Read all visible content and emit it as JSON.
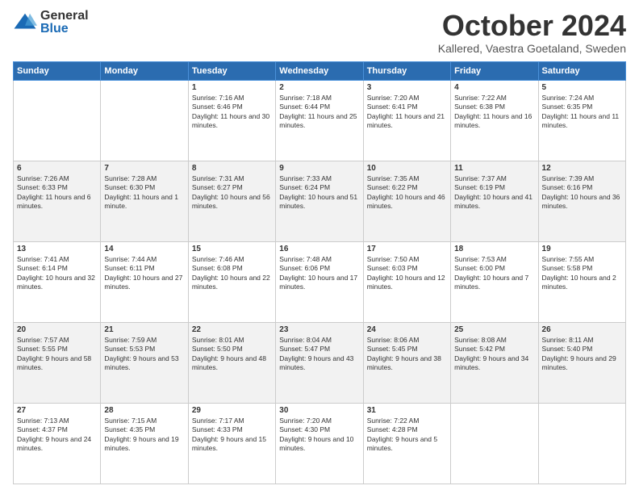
{
  "logo": {
    "general": "General",
    "blue": "Blue"
  },
  "title": "October 2024",
  "subtitle": "Kallered, Vaestra Goetaland, Sweden",
  "days_of_week": [
    "Sunday",
    "Monday",
    "Tuesday",
    "Wednesday",
    "Thursday",
    "Friday",
    "Saturday"
  ],
  "weeks": [
    [
      {
        "day": "",
        "sunrise": "",
        "sunset": "",
        "daylight": ""
      },
      {
        "day": "",
        "sunrise": "",
        "sunset": "",
        "daylight": ""
      },
      {
        "day": "1",
        "sunrise": "Sunrise: 7:16 AM",
        "sunset": "Sunset: 6:46 PM",
        "daylight": "Daylight: 11 hours and 30 minutes."
      },
      {
        "day": "2",
        "sunrise": "Sunrise: 7:18 AM",
        "sunset": "Sunset: 6:44 PM",
        "daylight": "Daylight: 11 hours and 25 minutes."
      },
      {
        "day": "3",
        "sunrise": "Sunrise: 7:20 AM",
        "sunset": "Sunset: 6:41 PM",
        "daylight": "Daylight: 11 hours and 21 minutes."
      },
      {
        "day": "4",
        "sunrise": "Sunrise: 7:22 AM",
        "sunset": "Sunset: 6:38 PM",
        "daylight": "Daylight: 11 hours and 16 minutes."
      },
      {
        "day": "5",
        "sunrise": "Sunrise: 7:24 AM",
        "sunset": "Sunset: 6:35 PM",
        "daylight": "Daylight: 11 hours and 11 minutes."
      }
    ],
    [
      {
        "day": "6",
        "sunrise": "Sunrise: 7:26 AM",
        "sunset": "Sunset: 6:33 PM",
        "daylight": "Daylight: 11 hours and 6 minutes."
      },
      {
        "day": "7",
        "sunrise": "Sunrise: 7:28 AM",
        "sunset": "Sunset: 6:30 PM",
        "daylight": "Daylight: 11 hours and 1 minute."
      },
      {
        "day": "8",
        "sunrise": "Sunrise: 7:31 AM",
        "sunset": "Sunset: 6:27 PM",
        "daylight": "Daylight: 10 hours and 56 minutes."
      },
      {
        "day": "9",
        "sunrise": "Sunrise: 7:33 AM",
        "sunset": "Sunset: 6:24 PM",
        "daylight": "Daylight: 10 hours and 51 minutes."
      },
      {
        "day": "10",
        "sunrise": "Sunrise: 7:35 AM",
        "sunset": "Sunset: 6:22 PM",
        "daylight": "Daylight: 10 hours and 46 minutes."
      },
      {
        "day": "11",
        "sunrise": "Sunrise: 7:37 AM",
        "sunset": "Sunset: 6:19 PM",
        "daylight": "Daylight: 10 hours and 41 minutes."
      },
      {
        "day": "12",
        "sunrise": "Sunrise: 7:39 AM",
        "sunset": "Sunset: 6:16 PM",
        "daylight": "Daylight: 10 hours and 36 minutes."
      }
    ],
    [
      {
        "day": "13",
        "sunrise": "Sunrise: 7:41 AM",
        "sunset": "Sunset: 6:14 PM",
        "daylight": "Daylight: 10 hours and 32 minutes."
      },
      {
        "day": "14",
        "sunrise": "Sunrise: 7:44 AM",
        "sunset": "Sunset: 6:11 PM",
        "daylight": "Daylight: 10 hours and 27 minutes."
      },
      {
        "day": "15",
        "sunrise": "Sunrise: 7:46 AM",
        "sunset": "Sunset: 6:08 PM",
        "daylight": "Daylight: 10 hours and 22 minutes."
      },
      {
        "day": "16",
        "sunrise": "Sunrise: 7:48 AM",
        "sunset": "Sunset: 6:06 PM",
        "daylight": "Daylight: 10 hours and 17 minutes."
      },
      {
        "day": "17",
        "sunrise": "Sunrise: 7:50 AM",
        "sunset": "Sunset: 6:03 PM",
        "daylight": "Daylight: 10 hours and 12 minutes."
      },
      {
        "day": "18",
        "sunrise": "Sunrise: 7:53 AM",
        "sunset": "Sunset: 6:00 PM",
        "daylight": "Daylight: 10 hours and 7 minutes."
      },
      {
        "day": "19",
        "sunrise": "Sunrise: 7:55 AM",
        "sunset": "Sunset: 5:58 PM",
        "daylight": "Daylight: 10 hours and 2 minutes."
      }
    ],
    [
      {
        "day": "20",
        "sunrise": "Sunrise: 7:57 AM",
        "sunset": "Sunset: 5:55 PM",
        "daylight": "Daylight: 9 hours and 58 minutes."
      },
      {
        "day": "21",
        "sunrise": "Sunrise: 7:59 AM",
        "sunset": "Sunset: 5:53 PM",
        "daylight": "Daylight: 9 hours and 53 minutes."
      },
      {
        "day": "22",
        "sunrise": "Sunrise: 8:01 AM",
        "sunset": "Sunset: 5:50 PM",
        "daylight": "Daylight: 9 hours and 48 minutes."
      },
      {
        "day": "23",
        "sunrise": "Sunrise: 8:04 AM",
        "sunset": "Sunset: 5:47 PM",
        "daylight": "Daylight: 9 hours and 43 minutes."
      },
      {
        "day": "24",
        "sunrise": "Sunrise: 8:06 AM",
        "sunset": "Sunset: 5:45 PM",
        "daylight": "Daylight: 9 hours and 38 minutes."
      },
      {
        "day": "25",
        "sunrise": "Sunrise: 8:08 AM",
        "sunset": "Sunset: 5:42 PM",
        "daylight": "Daylight: 9 hours and 34 minutes."
      },
      {
        "day": "26",
        "sunrise": "Sunrise: 8:11 AM",
        "sunset": "Sunset: 5:40 PM",
        "daylight": "Daylight: 9 hours and 29 minutes."
      }
    ],
    [
      {
        "day": "27",
        "sunrise": "Sunrise: 7:13 AM",
        "sunset": "Sunset: 4:37 PM",
        "daylight": "Daylight: 9 hours and 24 minutes."
      },
      {
        "day": "28",
        "sunrise": "Sunrise: 7:15 AM",
        "sunset": "Sunset: 4:35 PM",
        "daylight": "Daylight: 9 hours and 19 minutes."
      },
      {
        "day": "29",
        "sunrise": "Sunrise: 7:17 AM",
        "sunset": "Sunset: 4:33 PM",
        "daylight": "Daylight: 9 hours and 15 minutes."
      },
      {
        "day": "30",
        "sunrise": "Sunrise: 7:20 AM",
        "sunset": "Sunset: 4:30 PM",
        "daylight": "Daylight: 9 hours and 10 minutes."
      },
      {
        "day": "31",
        "sunrise": "Sunrise: 7:22 AM",
        "sunset": "Sunset: 4:28 PM",
        "daylight": "Daylight: 9 hours and 5 minutes."
      },
      {
        "day": "",
        "sunrise": "",
        "sunset": "",
        "daylight": ""
      },
      {
        "day": "",
        "sunrise": "",
        "sunset": "",
        "daylight": ""
      }
    ]
  ]
}
